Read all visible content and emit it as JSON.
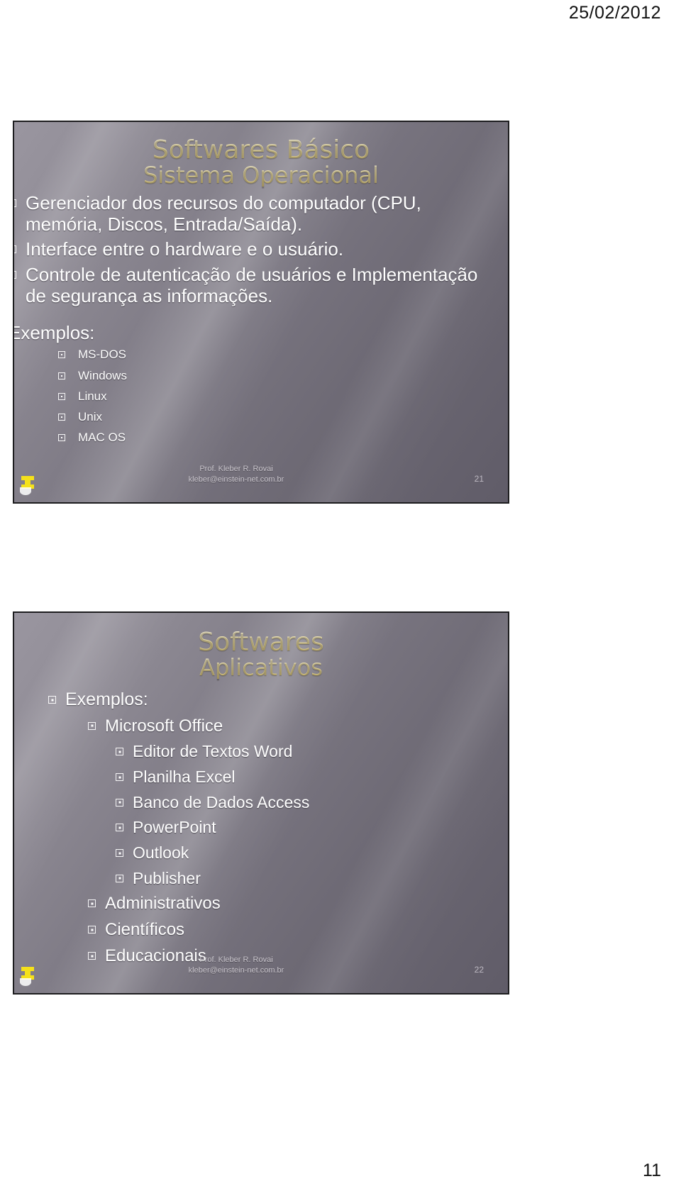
{
  "page": {
    "date": "25/02/2012",
    "page_number": "11"
  },
  "slides": [
    {
      "title_line_1": "Softwares Básico",
      "title_line_2": "Sistema Operacional",
      "bullets": [
        {
          "level": 1,
          "text": "Gerenciador dos recursos do computador (CPU, memória, Discos, Entrada/Saída)."
        },
        {
          "level": 1,
          "text": "Interface entre o hardware e o usuário."
        },
        {
          "level": 1,
          "text": "Controle de autenticação de usuários e Implementação de segurança as informações."
        }
      ],
      "examples_label": "Exemplos:",
      "examples": [
        "MS-DOS",
        "Windows",
        "Linux",
        "Unix",
        "MAC OS"
      ],
      "footer": {
        "presenter": "Prof. Kleber R. Rovai",
        "email": "kleber@einstein-net.com.br",
        "number": "21"
      }
    },
    {
      "title_line_1": "Softwares",
      "title_line_2": "Aplicativos",
      "items": [
        {
          "level": 1,
          "text": "Exemplos:"
        },
        {
          "level": 2,
          "text": "Microsoft Office"
        },
        {
          "level": 3,
          "text": "Editor de Textos Word"
        },
        {
          "level": 3,
          "text": "Planilha Excel"
        },
        {
          "level": 3,
          "text": "Banco de Dados Access"
        },
        {
          "level": 3,
          "text": "PowerPoint"
        },
        {
          "level": 3,
          "text": "Outlook"
        },
        {
          "level": 3,
          "text": "Publisher"
        },
        {
          "level": 2,
          "text": "Administrativos"
        },
        {
          "level": 2,
          "text": "Científicos"
        },
        {
          "level": 2,
          "text": "Educacionais"
        }
      ],
      "footer": {
        "presenter": "Prof. Kleber R. Rovai",
        "email": "kleber@einstein-net.com.br",
        "number": "22"
      }
    }
  ],
  "colors": {
    "title_gold": "#f1e3a6",
    "slide_bg": "#7b7782",
    "text": "#ffffff",
    "logo_yellow": "#f5e11a"
  }
}
